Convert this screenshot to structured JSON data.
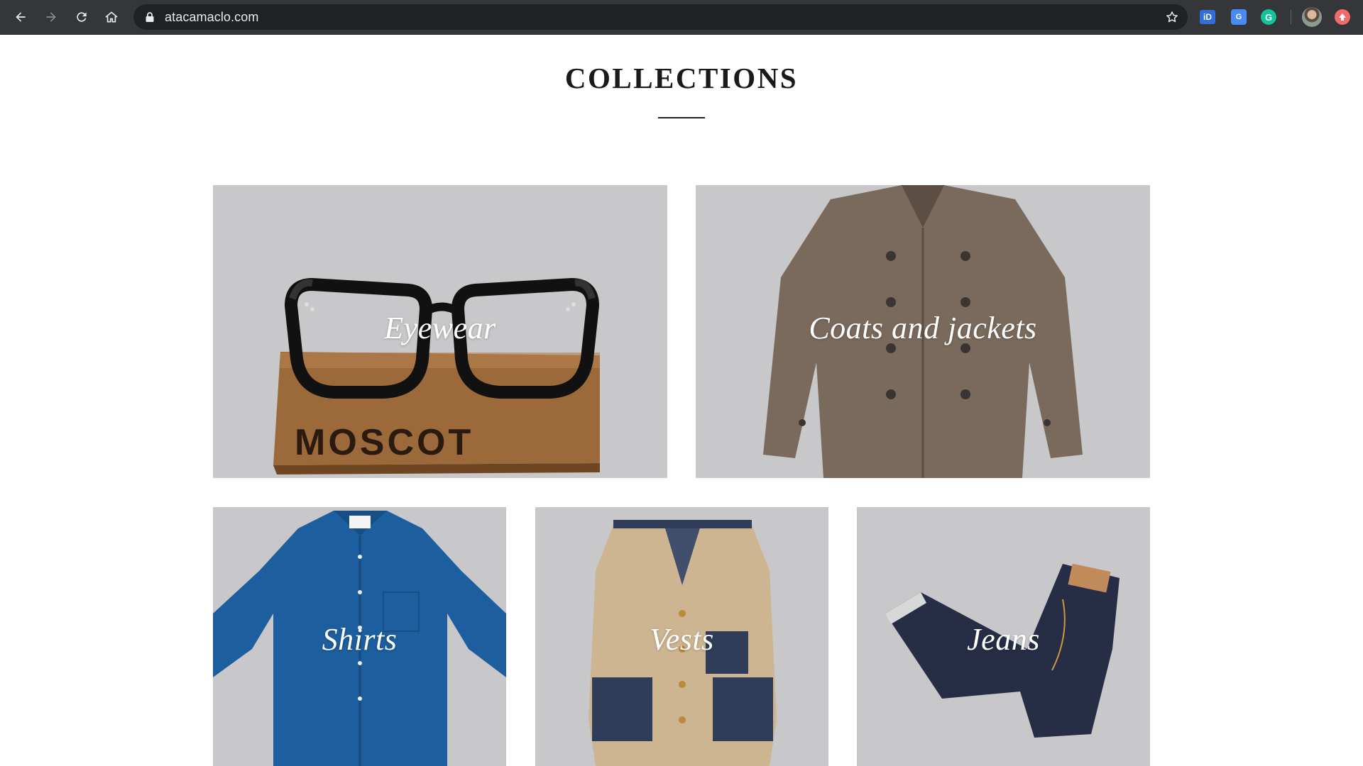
{
  "browser": {
    "url": "atacamaclo.com",
    "icons": [
      "back-icon",
      "forward-icon",
      "reload-icon",
      "home-icon",
      "lock-icon",
      "bookmark-star-icon"
    ],
    "extensions": [
      "id-extension-icon",
      "translate-extension-icon",
      "grammarly-extension-icon",
      "profile-avatar",
      "red-extension-icon"
    ]
  },
  "page": {
    "title": "COLLECTIONS"
  },
  "collections": [
    {
      "label": "Eyewear"
    },
    {
      "label": "Coats and jackets"
    },
    {
      "label": "Shirts"
    },
    {
      "label": "Vests"
    },
    {
      "label": "Jeans"
    }
  ],
  "product_branding": {
    "crate_text": "MOSCOT"
  },
  "colors": {
    "chrome_bg": "#35363a",
    "omnibox_bg": "#202124",
    "tile_bg": "#c9c8ca",
    "label": "#ffffff"
  }
}
